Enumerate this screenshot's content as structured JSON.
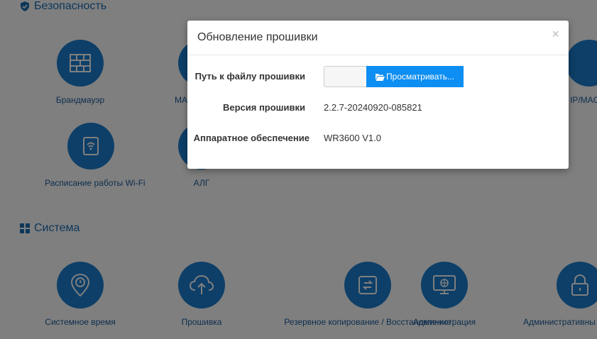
{
  "sections": {
    "security": {
      "title": "Безопасность"
    },
    "system": {
      "title": "Система"
    }
  },
  "security_tiles": [
    {
      "label": "Брандмауэр",
      "icon": "firewall-icon"
    },
    {
      "label": "MA",
      "icon": "mac-filter-icon"
    },
    {
      "label": "IP/MAC",
      "icon": "ip-mac-binding-icon"
    },
    {
      "label": "Расписание работы Wi-Fi",
      "icon": "wifi-schedule-icon"
    },
    {
      "label": "АЛГ",
      "icon": "alg-icon"
    }
  ],
  "system_tiles": [
    {
      "label": "Системное время",
      "icon": "clock-pin-icon"
    },
    {
      "label": "Прошивка",
      "icon": "cloud-upload-icon"
    },
    {
      "label": "Резервное копирование / Восстановление",
      "icon": "backup-restore-icon"
    },
    {
      "label": "Администрация",
      "icon": "remote-management-icon"
    },
    {
      "label": "Административны",
      "icon": "lock-icon"
    }
  ],
  "modal": {
    "title": "Обновление прошивки",
    "close_glyph": "×",
    "file_path_label": "Путь к файлу прошивки",
    "browse_label": "Просматривать...",
    "firmware_version_label": "Версия прошивки",
    "firmware_version": "2.2.7-20240920-085821",
    "hardware_label": "Аппаратное обеспечение",
    "hardware_value": "WR3600 V1.0"
  },
  "colors": {
    "accent": "#1a7fd1",
    "button": "#0d8ef2",
    "overlay": "rgba(0,0,0,0.5)"
  }
}
